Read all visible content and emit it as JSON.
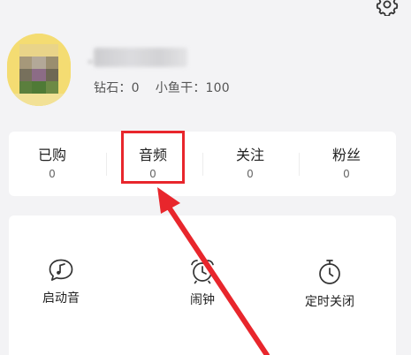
{
  "profile": {
    "assets": {
      "diamonds": "钻石：0",
      "fish": "小鱼干：100"
    }
  },
  "stats": [
    {
      "label": "已购",
      "count": "0"
    },
    {
      "label": "音频",
      "count": "0"
    },
    {
      "label": "关注",
      "count": "0"
    },
    {
      "label": "粉丝",
      "count": "0"
    }
  ],
  "tools": [
    {
      "label": "启动音",
      "icon": "music-note-bubble-icon"
    },
    {
      "label": "闹钟",
      "icon": "alarm-clock-icon"
    },
    {
      "label": "定时关闭",
      "icon": "stopwatch-icon"
    }
  ],
  "colors": {
    "annotation": "#e8262c",
    "card": "#ffffff",
    "background": "#f3f3f5"
  }
}
